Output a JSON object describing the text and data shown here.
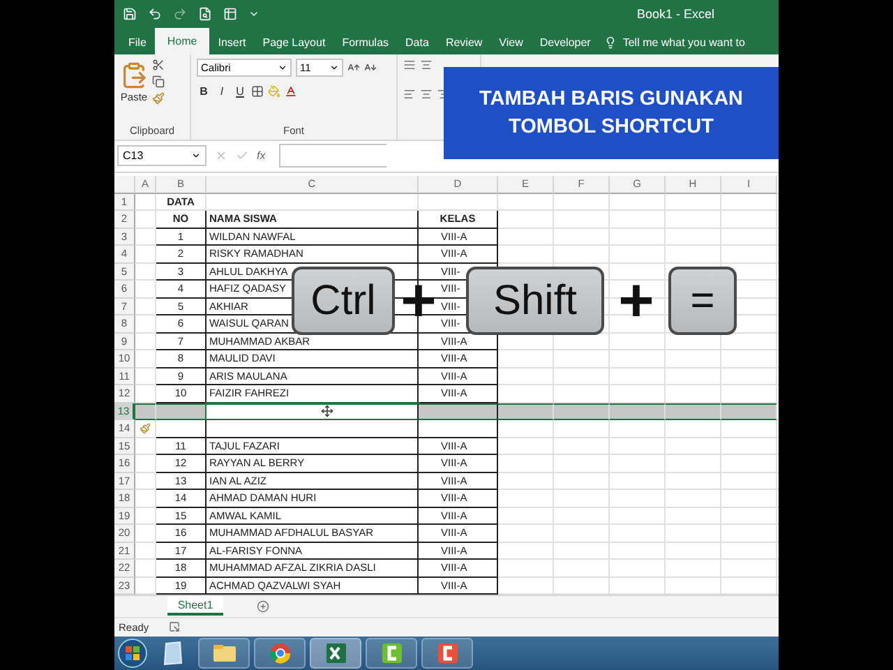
{
  "window": {
    "title": "Book1 - Excel"
  },
  "ribbon_tabs": [
    {
      "label": "File",
      "selected": false
    },
    {
      "label": "Home",
      "selected": true
    },
    {
      "label": "Insert",
      "selected": false
    },
    {
      "label": "Page Layout",
      "selected": false
    },
    {
      "label": "Formulas",
      "selected": false
    },
    {
      "label": "Data",
      "selected": false
    },
    {
      "label": "Review",
      "selected": false
    },
    {
      "label": "View",
      "selected": false
    },
    {
      "label": "Developer",
      "selected": false
    }
  ],
  "tell_me": "Tell me what you want to",
  "ribbon": {
    "paste": "Paste",
    "clipboard_group": "Clipboard",
    "font_name": "Calibri",
    "font_size": "11",
    "font_buttons": [
      "B",
      "I",
      "U"
    ],
    "font_group": "Font"
  },
  "formula_bar": {
    "name_box": "C13",
    "function_symbol": "fx"
  },
  "columns": [
    "A",
    "B",
    "C",
    "D",
    "E",
    "F",
    "G",
    "H",
    "I"
  ],
  "rows": [
    {
      "n": "1",
      "kind": "title",
      "no": "DATA",
      "selected": false
    },
    {
      "n": "2",
      "kind": "header",
      "no": "NO",
      "name": "NAMA SISWA",
      "kelas": "KELAS",
      "selected": false
    },
    {
      "n": "3",
      "kind": "data",
      "no": "1",
      "name": "WILDAN NAWFAL",
      "kelas": "VIII-A",
      "selected": false
    },
    {
      "n": "4",
      "kind": "data",
      "no": "2",
      "name": "RISKY RAMADHAN",
      "kelas": "VIII-A",
      "selected": false
    },
    {
      "n": "5",
      "kind": "data",
      "no": "3",
      "name": "AHLUL DAKHYA",
      "kelas": "VIII-",
      "selected": false
    },
    {
      "n": "6",
      "kind": "data",
      "no": "4",
      "name": "HAFIZ QADASY",
      "kelas": "VIII-",
      "selected": false
    },
    {
      "n": "7",
      "kind": "data",
      "no": "5",
      "name": "AKHIAR",
      "kelas": "VIII-",
      "selected": false
    },
    {
      "n": "8",
      "kind": "data",
      "no": "6",
      "name": "WAISUL QARAN",
      "kelas": "VIII-",
      "selected": false
    },
    {
      "n": "9",
      "kind": "data",
      "no": "7",
      "name": "MUHAMMAD AKBAR",
      "kelas": "VIII-A",
      "selected": false
    },
    {
      "n": "10",
      "kind": "data",
      "no": "8",
      "name": "MAULID DAVI",
      "kelas": "VIII-A",
      "selected": false
    },
    {
      "n": "11",
      "kind": "data",
      "no": "9",
      "name": "ARIS MAULANA",
      "kelas": "VIII-A",
      "selected": false
    },
    {
      "n": "12",
      "kind": "data",
      "no": "10",
      "name": "FAIZIR FAHREZI",
      "kelas": "VIII-A",
      "selected": false
    },
    {
      "n": "13",
      "kind": "blank",
      "selected": true
    },
    {
      "n": "14",
      "kind": "inserted",
      "selected": false
    },
    {
      "n": "15",
      "kind": "data",
      "no": "11",
      "name": "TAJUL FAZARI",
      "kelas": "VIII-A",
      "selected": false
    },
    {
      "n": "16",
      "kind": "data",
      "no": "12",
      "name": "RAYYAN AL BERRY",
      "kelas": "VIII-A",
      "selected": false
    },
    {
      "n": "17",
      "kind": "data",
      "no": "13",
      "name": "IAN AL AZIZ",
      "kelas": "VIII-A",
      "selected": false
    },
    {
      "n": "18",
      "kind": "data",
      "no": "14",
      "name": "AHMAD DAMAN HURI",
      "kelas": "VIII-A",
      "selected": false
    },
    {
      "n": "19",
      "kind": "data",
      "no": "15",
      "name": "AMWAL KAMIL",
      "kelas": "VIII-A",
      "selected": false
    },
    {
      "n": "20",
      "kind": "data",
      "no": "16",
      "name": "MUHAMMAD AFDHALUL BASYAR",
      "kelas": "VIII-A",
      "selected": false
    },
    {
      "n": "21",
      "kind": "data",
      "no": "17",
      "name": "AL-FARISY FONNA",
      "kelas": "VIII-A",
      "selected": false
    },
    {
      "n": "22",
      "kind": "data",
      "no": "18",
      "name": "MUHAMMAD AFZAL ZIKRIA DASLI",
      "kelas": "VIII-A",
      "selected": false
    },
    {
      "n": "23",
      "kind": "data",
      "no": "19",
      "name": "ACHMAD QAZVALWI SYAH",
      "kelas": "VIII-A",
      "selected": false
    }
  ],
  "sheet_tabs": [
    {
      "label": "Sheet1",
      "selected": true
    }
  ],
  "status_bar": {
    "text": "Ready"
  },
  "banner": {
    "lines": [
      "TAMBAH BARIS GUNAKAN",
      "TOMBOL SHORTCUT"
    ]
  },
  "shortcut": [
    {
      "kind": "key",
      "label": "Ctrl"
    },
    {
      "kind": "plus",
      "label": "+"
    },
    {
      "kind": "key",
      "label": "Shift"
    },
    {
      "kind": "plus",
      "label": "+"
    },
    {
      "kind": "key",
      "label": "="
    }
  ]
}
